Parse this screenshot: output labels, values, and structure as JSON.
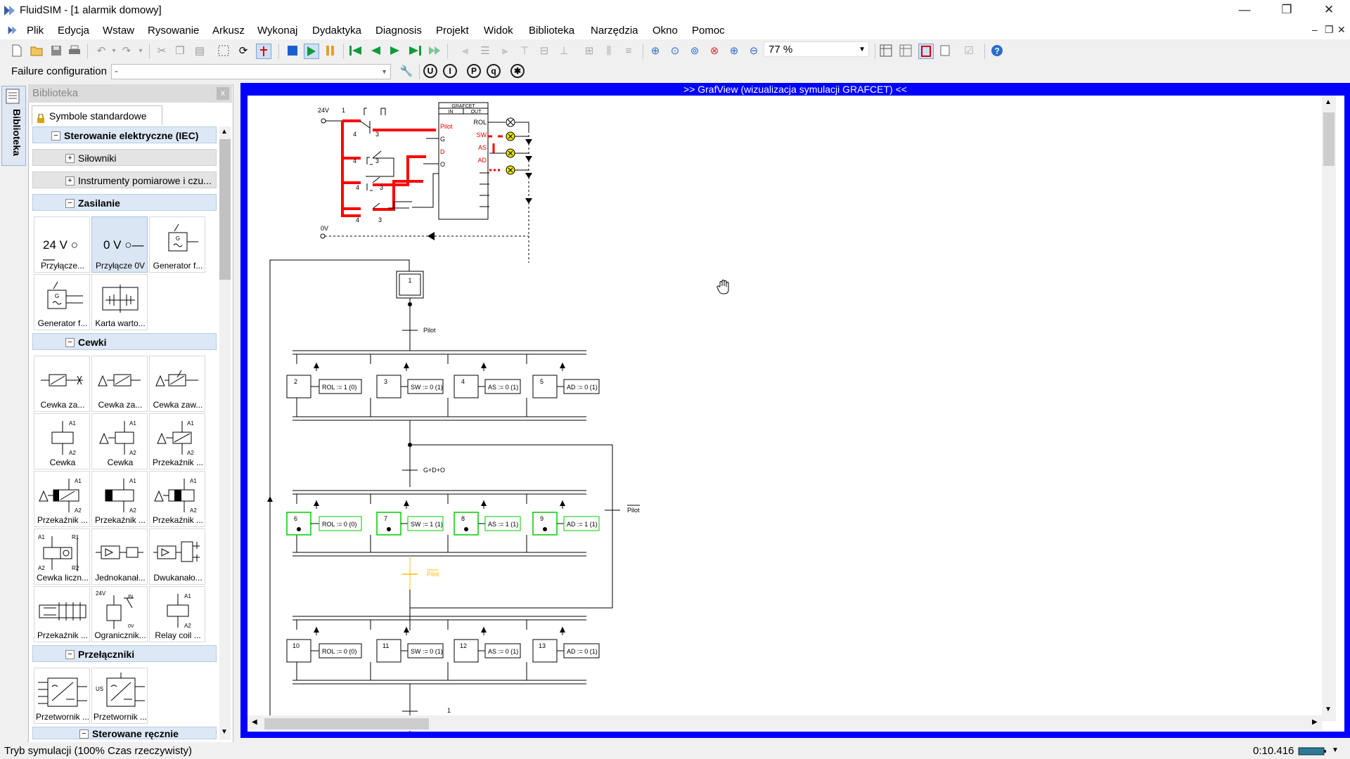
{
  "window": {
    "title": "FluidSIM - [1  alarmik domowy]",
    "controls": {
      "minimize": "—",
      "maximize": "❐",
      "close": "✕"
    }
  },
  "menu": {
    "items": [
      "Plik",
      "Edycja",
      "Wstaw",
      "Rysowanie",
      "Arkusz",
      "Wykonaj",
      "Dydaktyka",
      "Diagnosis",
      "Projekt",
      "Widok",
      "Biblioteka",
      "Narzędzia",
      "Okno",
      "Pomoc"
    ],
    "mdi_controls": {
      "minimize": "–",
      "restore": "❐",
      "close": "✕"
    }
  },
  "toolbar": {
    "zoom_value": "77 %",
    "failure_label": "Failure configuration",
    "failure_value": "-",
    "round_buttons": [
      "U",
      "I",
      "P",
      "q",
      "✱"
    ]
  },
  "sidebar": {
    "tab_label": "Biblioteka"
  },
  "library": {
    "header": "Biblioteka",
    "close": "x",
    "tab": "Symbole standardowe",
    "categories": {
      "c0": "Sterowanie elektryczne (IEC)",
      "c1": "Siłowniki",
      "c2": "Instrumenty pomiarowe i czu...",
      "c3": "Zasilanie",
      "c4": "Cewki",
      "c5": "Przełączniki",
      "c6": "Sterowane ręcznie"
    },
    "tiles": {
      "t0": "Przyłącze...",
      "t1": "Przyłącze 0V",
      "t2": "Generator f...",
      "t3": "Generator f...",
      "t4": "Karta warto...",
      "t5": "Cewka za...",
      "t6": "Cewka za...",
      "t7": "Cewka zaw...",
      "t8": "Cewka",
      "t9": "Cewka",
      "t10": "Przekaźnik ...",
      "t11": "Przekaźnik ...",
      "t12": "Przekaźnik ...",
      "t13": "Przekaźnik ...",
      "t14": "Cewka liczn...",
      "t15": "Jednokanał...",
      "t16": "Dwukanało...",
      "t17": "Przekaźnik ...",
      "t18": "Ogranicznik...",
      "t19": "Relay coil ...",
      "t20": "Przetwornik ...",
      "t21": "Przetwornik ..."
    },
    "tile_symbols": {
      "s24": "24 V ○—",
      "s0v": "0 V ○—"
    }
  },
  "document": {
    "title": ">> GrafView (wizualizacja symulacji GRAFCET) <<"
  },
  "diagram": {
    "supply_24v": "24V",
    "supply_0v": "0V",
    "node_1": "1",
    "num_4": "4",
    "num_3": "3",
    "grafcet_box": "GRAFCET",
    "in_label": "IN",
    "out_label": "OUT",
    "inputs": [
      "Pilot",
      "G",
      "D",
      "O"
    ],
    "outputs": [
      "ROL",
      "SW",
      "AS",
      "AD"
    ],
    "step1": "1",
    "t_pilot": "Pilot",
    "t_gdo": "G+D+O",
    "t_not_pilot_right": "Pilot",
    "t_not_pilot_mid": "Pilot",
    "t_bottom": "1",
    "row1": {
      "steps": [
        "2",
        "3",
        "4",
        "5"
      ],
      "actions": [
        "ROL := 1 (0)",
        "SW := 0 (1)",
        "AS := 0 (1)",
        "AD := 0 (1)"
      ]
    },
    "row2": {
      "steps": [
        "6",
        "7",
        "8",
        "9"
      ],
      "actions": [
        "ROL := 0 (0)",
        "SW := 1 (1)",
        "AS := 1 (1)",
        "AD := 1 (1)"
      ]
    },
    "row3": {
      "steps": [
        "10",
        "11",
        "12",
        "13"
      ],
      "actions": [
        "ROL := 0 (0)",
        "SW := 0 (1)",
        "AS := 0 (1)",
        "AD := 0 (1)"
      ]
    }
  },
  "status": {
    "left": "Tryb symulacji (100% Czas rzeczywisty)",
    "time": "0:10.416"
  },
  "colors": {
    "frame": "#0000ff",
    "active_wire": "#ff0000",
    "active_step": "#00cc00",
    "transition_hover": "#ffc000",
    "lamp": "#e8e800"
  }
}
